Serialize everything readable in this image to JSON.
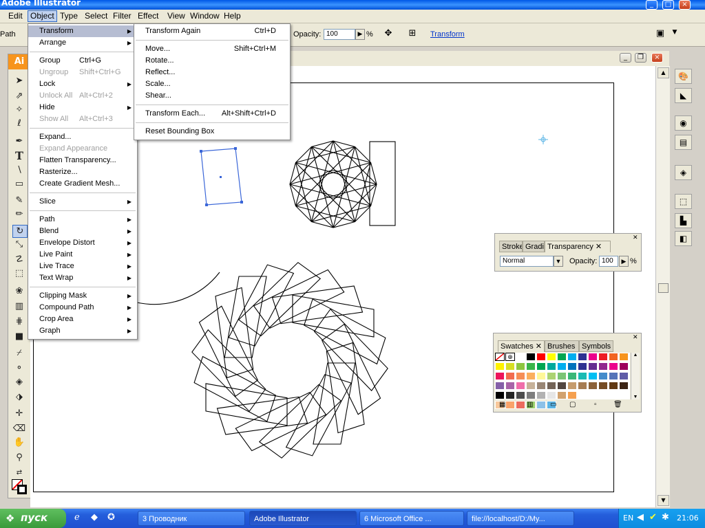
{
  "app": {
    "title": "Adobe Illustrator"
  },
  "menubar": [
    "Edit",
    "Object",
    "Type",
    "Select",
    "Filter",
    "Effect",
    "View",
    "Window",
    "Help"
  ],
  "controlbar": {
    "selection_label": "Path",
    "opacity_label": "Opacity:",
    "opacity_value": "100",
    "percent": "%",
    "transform_link": "Transform"
  },
  "object_menu": [
    {
      "label": "Transform",
      "shortcut": "",
      "submenu": true,
      "highlighted": true
    },
    {
      "label": "Arrange",
      "shortcut": "",
      "submenu": true
    },
    {
      "sep": true
    },
    {
      "label": "Group",
      "shortcut": "Ctrl+G"
    },
    {
      "label": "Ungroup",
      "shortcut": "Shift+Ctrl+G",
      "disabled": true
    },
    {
      "label": "Lock",
      "shortcut": "",
      "submenu": true
    },
    {
      "label": "Unlock All",
      "shortcut": "Alt+Ctrl+2",
      "disabled": true
    },
    {
      "label": "Hide",
      "shortcut": "",
      "submenu": true
    },
    {
      "label": "Show All",
      "shortcut": "Alt+Ctrl+3",
      "disabled": true
    },
    {
      "sep": true
    },
    {
      "label": "Expand...",
      "shortcut": ""
    },
    {
      "label": "Expand Appearance",
      "shortcut": "",
      "disabled": true
    },
    {
      "label": "Flatten Transparency...",
      "shortcut": ""
    },
    {
      "label": "Rasterize...",
      "shortcut": ""
    },
    {
      "label": "Create Gradient Mesh...",
      "shortcut": ""
    },
    {
      "sep": true
    },
    {
      "label": "Slice",
      "shortcut": "",
      "submenu": true
    },
    {
      "sep": true
    },
    {
      "label": "Path",
      "shortcut": "",
      "submenu": true
    },
    {
      "label": "Blend",
      "shortcut": "",
      "submenu": true
    },
    {
      "label": "Envelope Distort",
      "shortcut": "",
      "submenu": true
    },
    {
      "label": "Live Paint",
      "shortcut": "",
      "submenu": true
    },
    {
      "label": "Live Trace",
      "shortcut": "",
      "submenu": true
    },
    {
      "label": "Text Wrap",
      "shortcut": "",
      "submenu": true
    },
    {
      "sep": true
    },
    {
      "label": "Clipping Mask",
      "shortcut": "",
      "submenu": true
    },
    {
      "label": "Compound Path",
      "shortcut": "",
      "submenu": true
    },
    {
      "label": "Crop Area",
      "shortcut": "",
      "submenu": true
    },
    {
      "label": "Graph",
      "shortcut": "",
      "submenu": true
    }
  ],
  "transform_menu": [
    {
      "label": "Transform Again",
      "shortcut": "Ctrl+D"
    },
    {
      "sep": true
    },
    {
      "label": "Move...",
      "shortcut": "Shift+Ctrl+M"
    },
    {
      "label": "Rotate...",
      "shortcut": ""
    },
    {
      "label": "Reflect...",
      "shortcut": ""
    },
    {
      "label": "Scale...",
      "shortcut": ""
    },
    {
      "label": "Shear...",
      "shortcut": ""
    },
    {
      "sep": true
    },
    {
      "label": "Transform Each...",
      "shortcut": "Alt+Shift+Ctrl+D"
    },
    {
      "sep": true
    },
    {
      "label": "Reset Bounding Box",
      "shortcut": ""
    }
  ],
  "transparency_panel": {
    "tabs": [
      "Stroke",
      "Gradient",
      "Transparency"
    ],
    "blend_mode": "Normal",
    "opacity_label": "Opacity:",
    "opacity_value": "100",
    "percent": "%"
  },
  "swatches_panel": {
    "tabs": [
      "Swatches",
      "Brushes",
      "Symbols"
    ],
    "rows": [
      [
        "none",
        "reg",
        "#ffffff",
        "#000000",
        "#ff0000",
        "#ffff00",
        "#00a651",
        "#00aeef",
        "#2e3192",
        "#ec008c",
        "#ed1c24",
        "#f26522",
        "#f7941d"
      ],
      [
        "#fff200",
        "#d7df23",
        "#8dc63f",
        "#39b54a",
        "#00a651",
        "#00a99d",
        "#00aeef",
        "#0072bc",
        "#2e3192",
        "#662d91",
        "#92278f",
        "#ec008c",
        "#9e005d"
      ],
      [
        "#ed145b",
        "#f26c4f",
        "#f68e56",
        "#fbaf5d",
        "#fff799",
        "#acd373",
        "#7cc576",
        "#3bb878",
        "#1abbb4",
        "#00bff3",
        "#448ccb",
        "#5574b9",
        "#605ca8"
      ],
      [
        "#8560a8",
        "#a864a8",
        "#f06eaa",
        "#c7b299",
        "#998675",
        "#736357",
        "#534741",
        "#c69c6d",
        "#a67c52",
        "#8c6239",
        "#754c24",
        "#603913",
        "#3c2415"
      ],
      [
        "#000000",
        "#252525",
        "#4d4d4d",
        "#7f7f7f",
        "#b2b2b2",
        "#e6e6e6",
        "#d2a26f",
        "#f5a04f"
      ],
      [
        "#f7c89b",
        "#f9a36b",
        "#ec6b5e",
        "#9bd06b",
        "#8cc1e8",
        "#5ab4e5"
      ]
    ]
  },
  "taskbar": {
    "start": "пуск",
    "tasks": [
      {
        "label": "3 Проводник",
        "active": false
      },
      {
        "label": "Adobe Illustrator",
        "active": true
      },
      {
        "label": "6 Microsoft Office ...",
        "active": false
      },
      {
        "label": "file://localhost/D:/My...",
        "active": false
      }
    ],
    "lang": "EN",
    "clock": "21:06"
  }
}
